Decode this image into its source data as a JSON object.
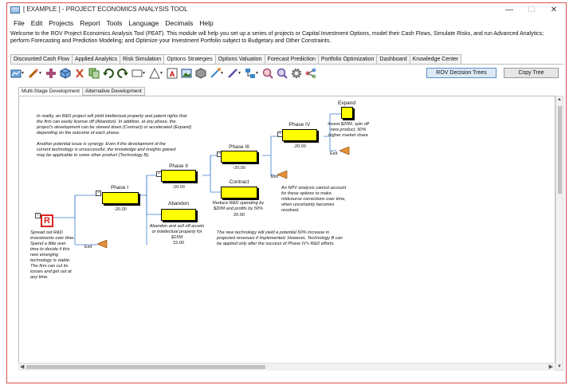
{
  "window": {
    "title": "[ EXAMPLE ] - PROJECT ECONOMICS ANALYSIS TOOL",
    "min": "—",
    "max": "☐",
    "close": "✕"
  },
  "menu": [
    "File",
    "Edit",
    "Projects",
    "Report",
    "Tools",
    "Language",
    "Decimals",
    "Help"
  ],
  "description": "Welcome to the ROV Project Economics Analysis Tool (PEAT). This module will help you set up a series of projects or Capital Investment Options, model their Cash Flows, Simulate Risks, and run Advanced Analytics; perform Forecasting and Prediction Modeling; and Optimize your Investment Portfolio subject to Budgetary and Other Constraints.",
  "tabs": [
    "Discounted Cash Flow",
    "Applied Analytics",
    "Risk Simulation",
    "Options Strategies",
    "Options Valuation",
    "Forecast Prediction",
    "Portfolio Optimization",
    "Dashboard",
    "Knowledge Center"
  ],
  "active_tab": 3,
  "toolbar": {
    "decision_trees": "ROV Decision Trees",
    "copy_tree": "Copy Tree"
  },
  "subtabs": [
    "Multi-Stage Development",
    "Alternative Development"
  ],
  "tree": {
    "phase1": {
      "label": "Phase I",
      "value": "-20.00"
    },
    "phase2": {
      "label": "Phase II",
      "value": "-20.00"
    },
    "phase3": {
      "label": "Phase III",
      "value": "-20.00"
    },
    "phase4": {
      "label": "Phase IV",
      "value": "-20.00"
    },
    "abandon": {
      "label": "Abandon",
      "note": "Abandon and sell off assets or intellectual property for $15M",
      "value": "15.00"
    },
    "contract": {
      "label": "Contract",
      "note": "Reduce R&D spending by $20M and profits by 50%",
      "value": "20.00"
    },
    "expand": {
      "label": "Expand",
      "note": "Invest $20M, spin off new product, 50% higher market share"
    },
    "exit_label": "Exit",
    "start_note": "Spread out R&D investments over time. Spend a little over time to decide if this new emerging technology is viable. The firm can cut its losses and get out at any time.",
    "intro_note_1": "In reality, an R&D project will yield intellectual property and patent rights that the firm can easily license off (Abandon). In addition, at any phase, the project's development can be slowed down (Contract) or accelerated (Expand) depending on the outcome of each phase.",
    "intro_note_2": "Another potential issue is synergy. Even if the development of the current technology is unsuccessful, the knowledge and insights gained may be applicable to some other product (Technology B).",
    "npv_note": "An NPV analysis cannot account for these options to make midcourse corrections over time, when uncertainty becomes resolved.",
    "tech_note": "The new technology will yield a potential 50% increase in projected revenues if implemented. However, Technology B can be applied only after the success of Phase IV's R&D efforts."
  },
  "icons": [
    "chart-icon",
    "pencil-icon",
    "add-node-icon",
    "cube-icon",
    "cut-icon",
    "copy-icon",
    "undo-icon",
    "redo-icon",
    "rectangle-icon",
    "triangle-icon",
    "text-icon",
    "image-icon",
    "hexagon-icon",
    "line-icon",
    "pen-icon",
    "connector-icon",
    "zoom-in-icon",
    "zoom-out-icon",
    "settings-icon",
    "share-icon"
  ]
}
